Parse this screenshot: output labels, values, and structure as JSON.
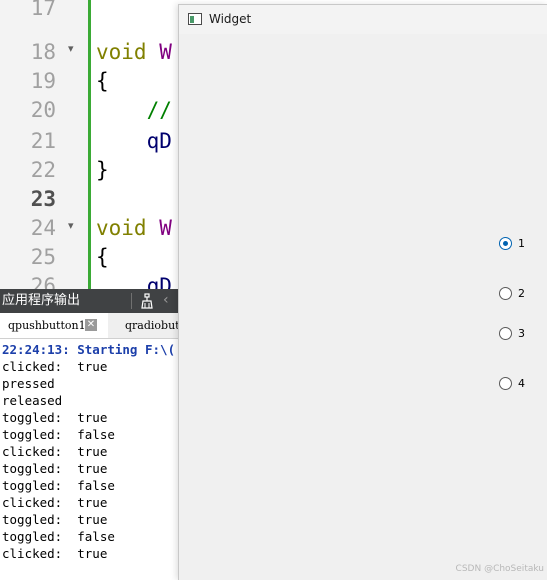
{
  "editor": {
    "lines": [
      {
        "num": "17",
        "text": ""
      },
      {
        "num": "18",
        "text": "void W",
        "fold": true
      },
      {
        "num": "19",
        "text": "{"
      },
      {
        "num": "20",
        "text": "    //"
      },
      {
        "num": "21",
        "text": "    qD"
      },
      {
        "num": "22",
        "text": "}"
      },
      {
        "num": "23",
        "text": "",
        "current": true
      },
      {
        "num": "24",
        "text": "void W",
        "fold": true
      },
      {
        "num": "25",
        "text": "{"
      },
      {
        "num": "26",
        "text": "    qD"
      }
    ]
  },
  "output_pane": {
    "title": "应用程序输出",
    "tabs": [
      {
        "label": "qpushbutton1"
      },
      {
        "label": "qradiobut"
      }
    ],
    "lines": [
      {
        "text": "22:24:13: Starting F:\\(",
        "style": "blue"
      },
      {
        "text": "clicked:  true"
      },
      {
        "text": "pressed"
      },
      {
        "text": "released"
      },
      {
        "text": "toggled:  true"
      },
      {
        "text": "toggled:  false"
      },
      {
        "text": "clicked:  true"
      },
      {
        "text": "toggled:  true"
      },
      {
        "text": "toggled:  false"
      },
      {
        "text": "clicked:  true"
      },
      {
        "text": "toggled:  true"
      },
      {
        "text": "toggled:  false"
      },
      {
        "text": "clicked:  true"
      }
    ]
  },
  "widget": {
    "title": "Widget",
    "radios": [
      {
        "label": "1",
        "checked": true
      },
      {
        "label": "2",
        "checked": false
      },
      {
        "label": "3",
        "checked": false
      },
      {
        "label": "4",
        "checked": false
      }
    ],
    "watermark": "CSDN @ChoSeitaku"
  },
  "colors": {
    "keyword": "#808000",
    "function": "#800080",
    "comment": "#008000",
    "identifier": "#00006e",
    "radio_accent": "#0063b1",
    "change_bar": "#3aaa35",
    "output_header_bg": "#404244",
    "output_start_text": "#1c3faa"
  }
}
